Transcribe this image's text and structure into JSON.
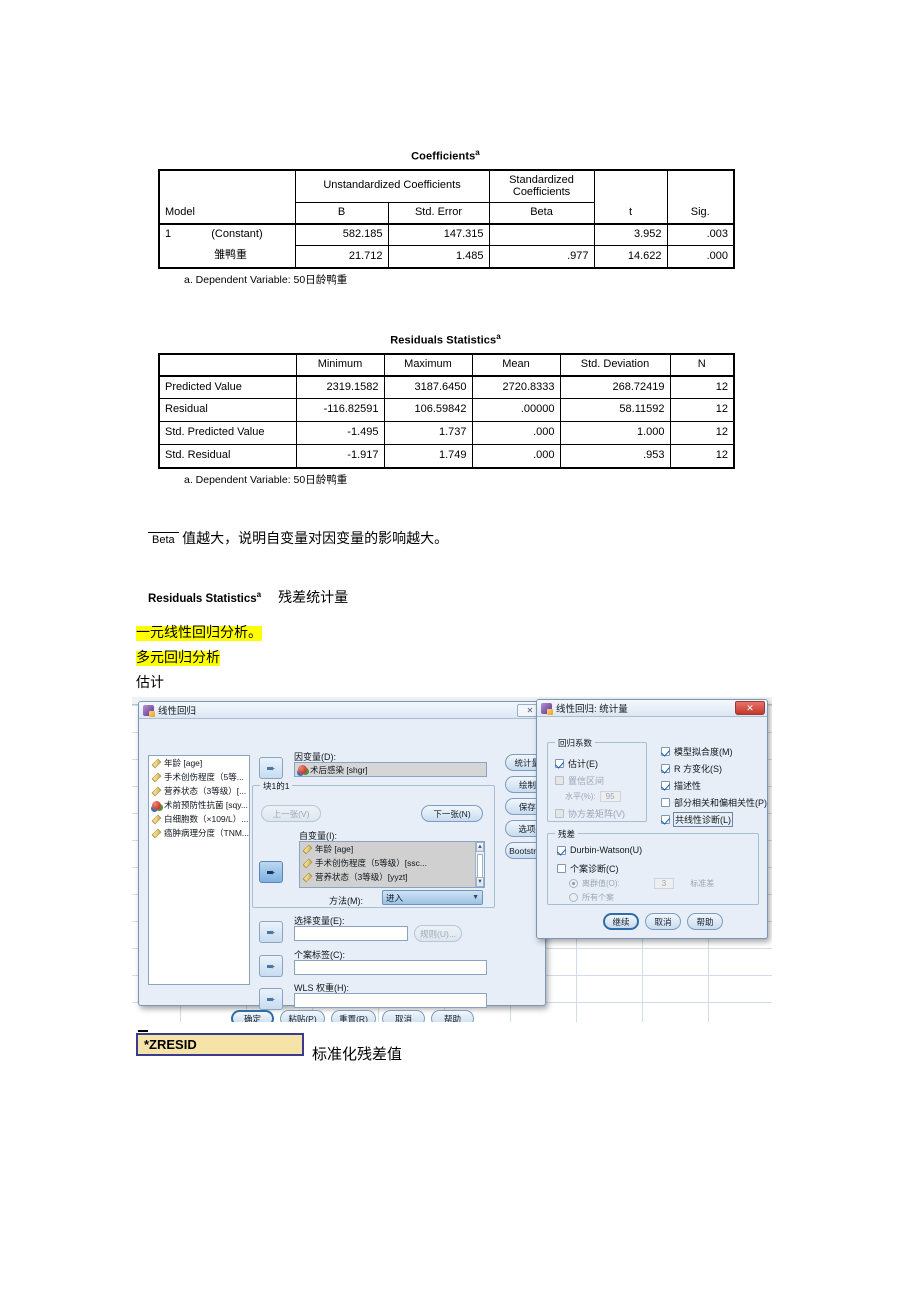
{
  "doc": {
    "coefficients": {
      "title": "Coefficients",
      "title_sup": "a",
      "header_model": "Model",
      "group_unstd": "Unstandardized Coefficients",
      "group_std_line1": "Standardized",
      "group_std_line2": "Coefficients",
      "col_b": "B",
      "col_se": "Std. Error",
      "col_beta": "Beta",
      "col_t": "t",
      "col_sig": "Sig.",
      "rows": [
        {
          "model": "1",
          "name": "(Constant)",
          "b": "582.185",
          "se": "147.315",
          "beta": "",
          "t": "3.952",
          "sig": ".003"
        },
        {
          "model": "",
          "name": "雏鸭重",
          "b": "21.712",
          "se": "1.485",
          "beta": ".977",
          "t": "14.622",
          "sig": ".000"
        }
      ],
      "footnote": "a. Dependent Variable: 50日龄鸭重"
    },
    "residuals": {
      "title": "Residuals Statistics",
      "title_sup": "a",
      "columns": [
        "",
        "Minimum",
        "Maximum",
        "Mean",
        "Std. Deviation",
        "N"
      ],
      "rows": [
        {
          "label": "Predicted Value",
          "min": "2319.1582",
          "max": "3187.6450",
          "mean": "2720.8333",
          "sd": "268.72419",
          "n": "12"
        },
        {
          "label": "Residual",
          "min": "-116.82591",
          "max": "106.59842",
          "mean": ".00000",
          "sd": "58.11592",
          "n": "12"
        },
        {
          "label": "Std. Predicted Value",
          "min": "-1.495",
          "max": "1.737",
          "mean": ".000",
          "sd": "1.000",
          "n": "12"
        },
        {
          "label": "Std. Residual",
          "min": "-1.917",
          "max": "1.749",
          "mean": ".000",
          "sd": ".953",
          "n": "12"
        }
      ],
      "footnote": "a. Dependent Variable: 50日龄鸭重"
    },
    "notes": {
      "beta_token": "Beta",
      "beta_sentence": "值越大，说明自变量对因变量的影响越大。",
      "rs_label": "Residuals Statistics",
      "rs_label_sup": "a",
      "rs_translation": "残差统计量",
      "hl_line1": "一元线性回归分析。",
      "hl_line2": "多元回归分析",
      "line3": "估计"
    },
    "zresid": {
      "value": "*ZRESID",
      "caption": "标准化残差值"
    }
  },
  "dialog_linreg": {
    "title": "线性回归",
    "close_label": "✕",
    "source_vars": [
      {
        "label": "年龄 [age]",
        "icon": "scale-icon"
      },
      {
        "label": "手术创伤程度（5等...",
        "icon": "scale-icon"
      },
      {
        "label": "营养状态（3等级）[...",
        "icon": "scale-icon"
      },
      {
        "label": "术前预防性抗菌 [sqy...",
        "icon": "nominal-icon"
      },
      {
        "label": "白细胞数（×109/L）...",
        "icon": "scale-icon"
      },
      {
        "label": "癌肿病理分度（TNM...",
        "icon": "scale-icon"
      }
    ],
    "dependent_label": "因变量(D):",
    "dependent_value": "术后感染 [shgr]",
    "block_label": "块1的1",
    "prev_button": "上一张(V)",
    "next_button": "下一张(N)",
    "independent_label": "自变量(I):",
    "independent_vars": [
      "年龄 [age]",
      "手术创伤程度（5等级）[ssc...",
      "营养状态（3等级）[yyzt]"
    ],
    "method_label": "方法(M):",
    "method_value": "进入",
    "selection_label": "选择变量(E):",
    "selection_value": "",
    "rule_button": "规则(U)...",
    "caselabel_label": "个案标签(C):",
    "caselabel_value": "",
    "wls_label": "WLS 权重(H):",
    "wls_value": "",
    "side_buttons": [
      "统计量(S)...",
      "绘制(T)...",
      "保存(S)...",
      "选项(O)...",
      "Bootstrap(B)..."
    ],
    "bottom_buttons": [
      "确定",
      "粘贴(P)",
      "重置(R)",
      "取消",
      "帮助"
    ]
  },
  "dialog_stats": {
    "title": "线性回归: 统计量",
    "close_label": "✕",
    "group_regression_coef": "回归系数",
    "left_options": [
      {
        "label": "估计(E)",
        "checked": true,
        "disabled": false
      },
      {
        "label": "置信区间",
        "checked": false,
        "disabled": true
      },
      {
        "label": "协方差矩阵(V)",
        "checked": false,
        "disabled": true
      }
    ],
    "level_label": "水平(%):",
    "level_value": "95",
    "right_options": [
      {
        "label": "模型拟合度(M)",
        "checked": true,
        "disabled": false
      },
      {
        "label": "R 方变化(S)",
        "checked": true,
        "disabled": false
      },
      {
        "label": "描述性",
        "checked": true,
        "disabled": false
      },
      {
        "label": "部分相关和偏相关性(P)",
        "checked": false,
        "disabled": false
      },
      {
        "label": "共线性诊断(L)",
        "checked": true,
        "disabled": false
      }
    ],
    "group_residual": "残差",
    "durbin_watson": {
      "label": "Durbin-Watson(U)",
      "checked": true
    },
    "case_diagnostics": {
      "label": "个案诊断(C)",
      "checked": false
    },
    "outliers_label": "离群值(O):",
    "outliers_value": "3",
    "outliers_unit": "标准差",
    "all_cases_label": "所有个案",
    "bottom_buttons": [
      "继续",
      "取消",
      "帮助"
    ]
  },
  "colors": {
    "highlight": "#ffff00",
    "dialog_bg": "#e8eef7",
    "zresid_bg": "#f5e3a8",
    "zresid_border": "#3b3b8f"
  }
}
